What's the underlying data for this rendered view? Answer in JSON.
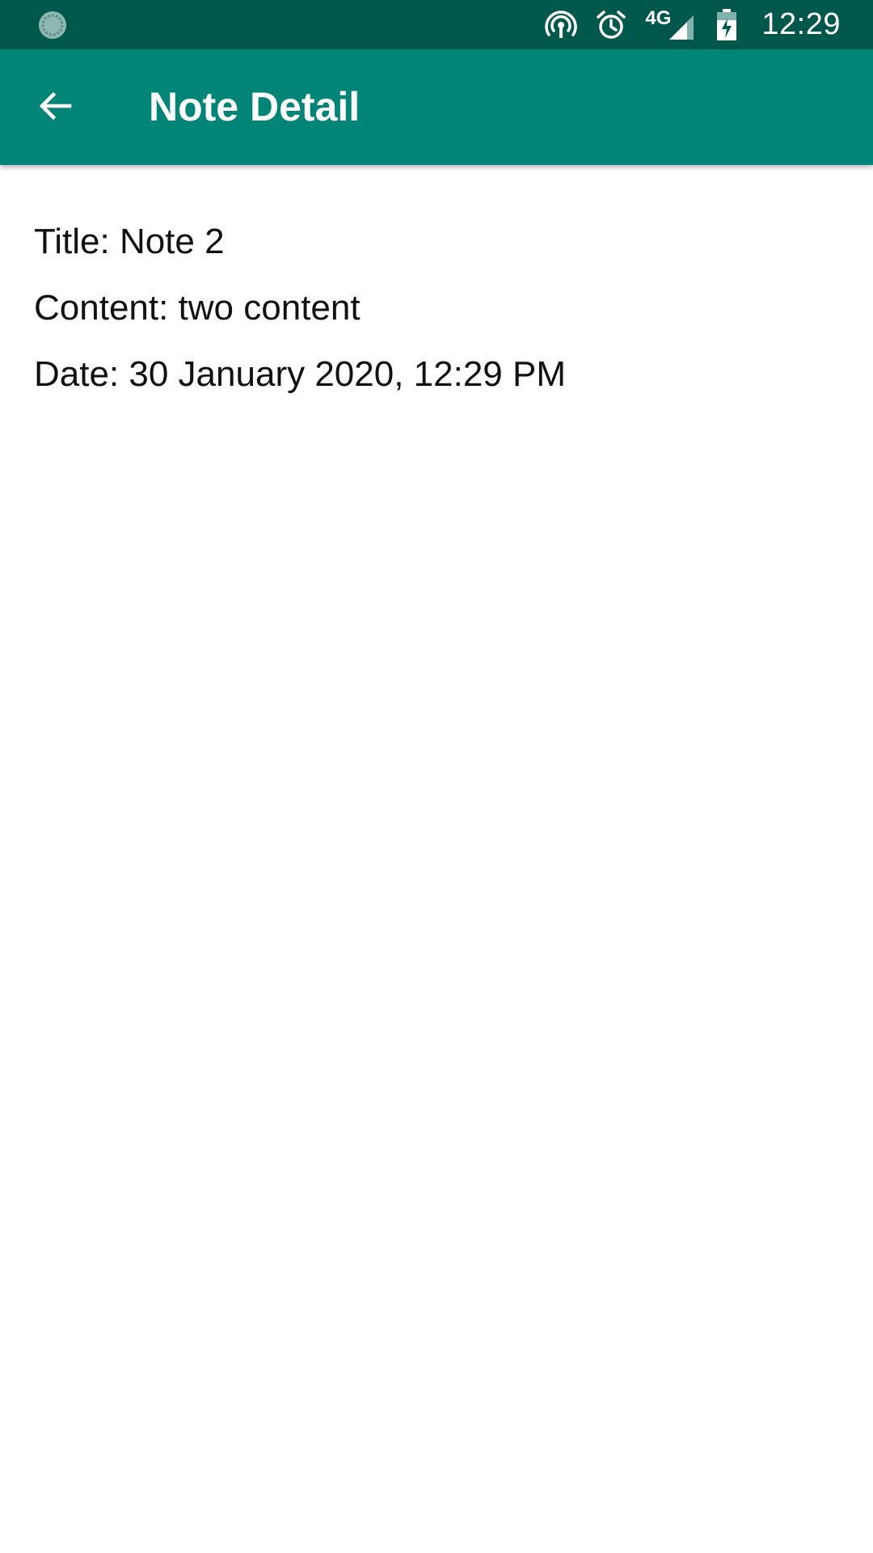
{
  "status_bar": {
    "network_type": "4G",
    "time": "12:29",
    "icons": [
      "sync-icon",
      "hotspot-icon",
      "alarm-icon",
      "signal-icon",
      "battery-charging-icon"
    ]
  },
  "app_bar": {
    "title": "Note Detail",
    "back_icon": "arrow-back-icon",
    "color": "#008577",
    "status_color": "#00574b"
  },
  "note": {
    "title_line": "Title: Note 2",
    "content_line": "Content: two content",
    "date_line": "Date: 30 January 2020, 12:29 PM"
  }
}
